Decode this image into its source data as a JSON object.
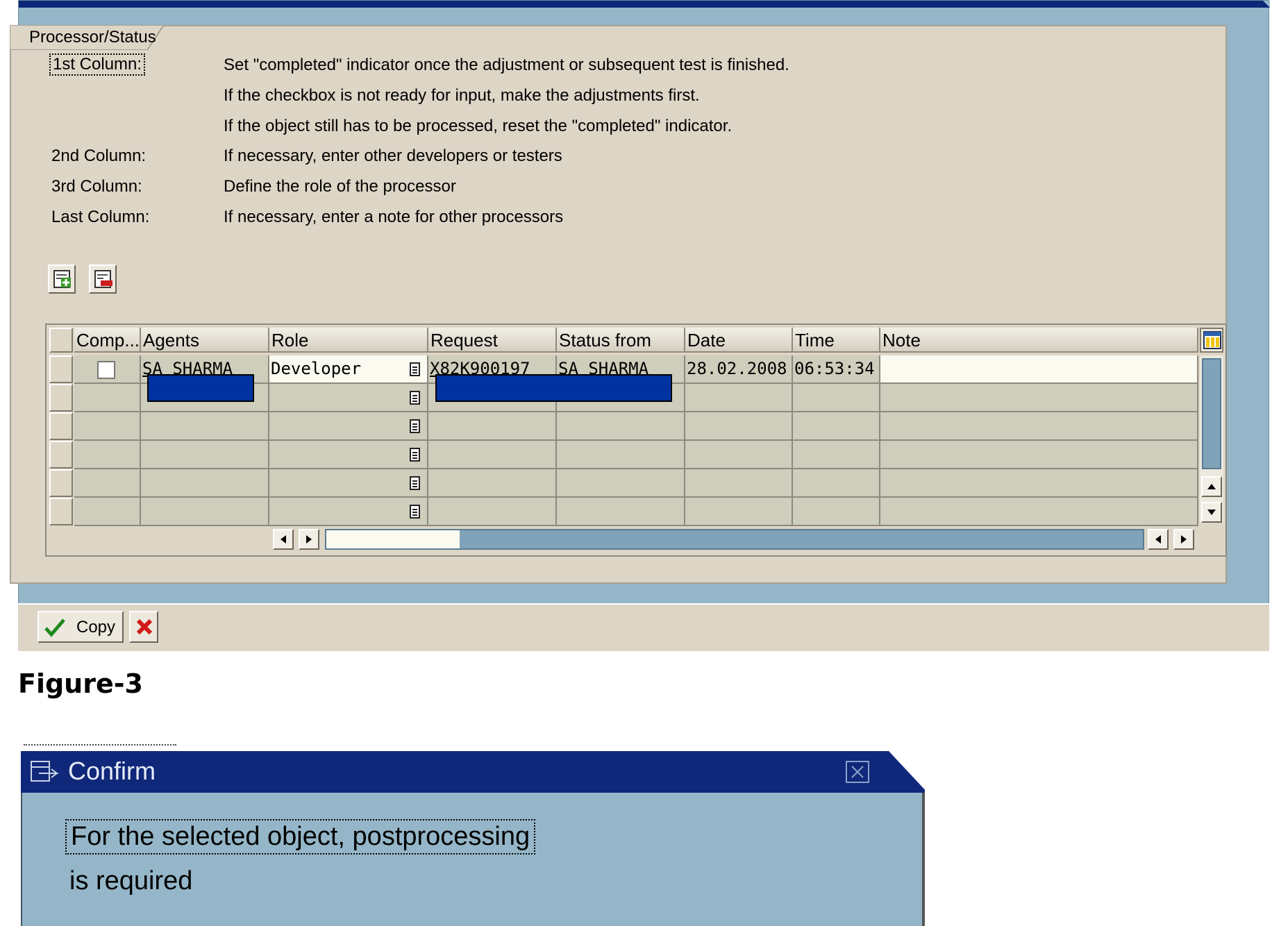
{
  "top_dialog": {
    "group_title": "Processor/Status",
    "help": [
      {
        "label": "1st Column:",
        "text": "Set \"completed\" indicator once the adjustment or subsequent test is finished."
      },
      {
        "label": "",
        "text": "If the checkbox is not ready for input, make the adjustments first."
      },
      {
        "label": "",
        "text": "If the object still has to be processed, reset the \"completed\" indicator."
      },
      {
        "label": "2nd Column:",
        "text": "If necessary, enter other developers or testers"
      },
      {
        "label": "3rd Column:",
        "text": "Define the role of the processor"
      },
      {
        "label": "Last Column:",
        "text": "If necessary, enter a note for other processors"
      }
    ],
    "toolbar": {
      "insert_icon": "insert-row-icon",
      "delete_icon": "delete-row-icon"
    },
    "table": {
      "columns": [
        "Comp...",
        "Agents",
        "Role",
        "Request",
        "Status from",
        "Date",
        "Time",
        "Note"
      ],
      "rows": [
        {
          "completed": false,
          "agent": "SA_SHARMA",
          "role": "Developer",
          "request": "X82K900197",
          "status_from": "SA_SHARMA",
          "date": "28.02.2008",
          "time": "06:53:34",
          "note": ""
        }
      ]
    },
    "buttons": {
      "copy": "Copy"
    }
  },
  "figure_caption": "Figure-3",
  "confirm_dialog": {
    "title": "Confirm",
    "message_line1": "For the selected object, postprocessing",
    "message_line2": "is required"
  },
  "colors": {
    "title_bar": "#10287a",
    "dialog_bg": "#94b6c8",
    "panel_bg": "#ddd5c6",
    "redaction": "#0033a0"
  }
}
